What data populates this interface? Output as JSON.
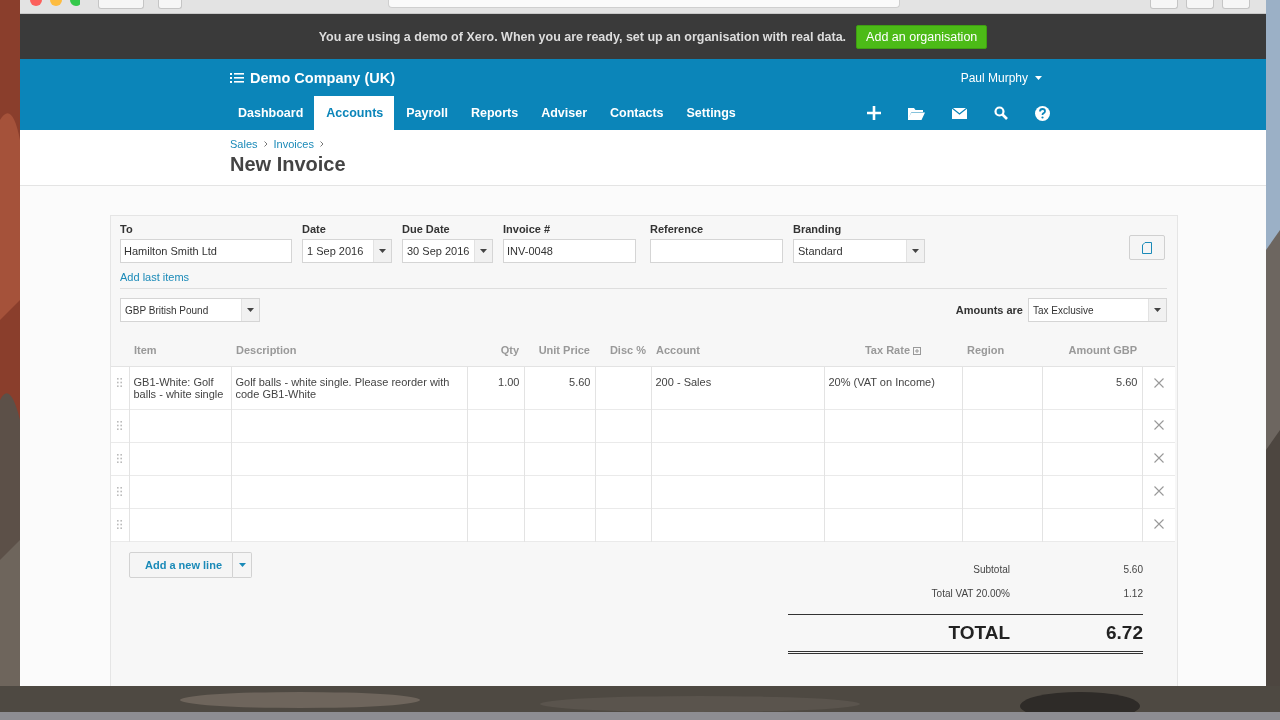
{
  "banner": {
    "message": "You are using a demo of Xero. When you are ready, set up an organisation with real data.",
    "button": "Add an organisation"
  },
  "header": {
    "company": "Demo Company (UK)",
    "user": "Paul Murphy",
    "nav": [
      {
        "label": "Dashboard",
        "selected": false
      },
      {
        "label": "Accounts",
        "selected": true
      },
      {
        "label": "Payroll",
        "selected": false
      },
      {
        "label": "Reports",
        "selected": false
      },
      {
        "label": "Adviser",
        "selected": false
      },
      {
        "label": "Contacts",
        "selected": false
      },
      {
        "label": "Settings",
        "selected": false
      }
    ]
  },
  "breadcrumbs": [
    "Sales",
    "Invoices"
  ],
  "title": "New Invoice",
  "fields": [
    {
      "label": "To",
      "value": "Hamilton Smith Ltd",
      "kind": "text"
    },
    {
      "label": "Date",
      "value": "1 Sep 2016",
      "kind": "select"
    },
    {
      "label": "Due Date",
      "value": "30 Sep 2016",
      "kind": "select"
    },
    {
      "label": "Invoice #",
      "value": "INV-0048",
      "kind": "text"
    },
    {
      "label": "Reference",
      "kind": "text"
    },
    {
      "label": "Branding",
      "value": "Standard",
      "kind": "select"
    }
  ],
  "add_last_items": "Add last items",
  "currency": "GBP British Pound",
  "amounts_are": {
    "label": "Amounts are",
    "value": "Tax Exclusive"
  },
  "table": {
    "columns": [
      "Item",
      "Description",
      "Qty",
      "Unit Price",
      "Disc %",
      "Account",
      "Tax Rate",
      "Region",
      "Amount GBP"
    ],
    "rows": [
      {
        "item": "GB1-White: Golf balls - white single",
        "description": "Golf balls - white single. Please reorder with code GB1-White",
        "qty": "1.00",
        "unit_price": "5.60",
        "account": "200 - Sales",
        "tax_rate": "20% (VAT on Income)",
        "amount": "5.60"
      },
      {},
      {},
      {},
      {}
    ]
  },
  "add_line_button": "Add a new line",
  "totals": {
    "subtotal": {
      "label": "Subtotal",
      "value": "5.60"
    },
    "vat": {
      "label": "Total VAT 20.00%",
      "value": "1.12"
    },
    "total": {
      "label": "TOTAL",
      "value": "6.72"
    }
  }
}
